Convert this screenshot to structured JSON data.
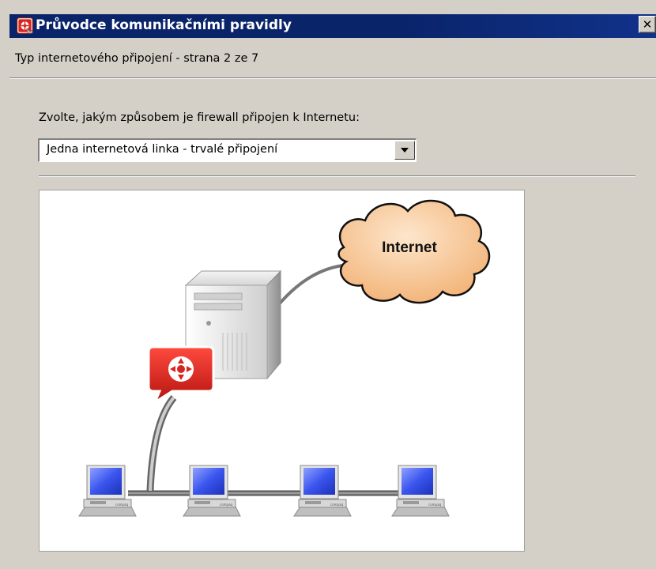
{
  "window": {
    "title": "Průvodce komunikačními pravidly",
    "app_icon": "firewall-wizard-icon",
    "close_icon": "close-icon",
    "close_label": "✕"
  },
  "page": {
    "subtitle": "Typ internetového připojení - strana 2 ze 7",
    "prompt": "Zvolte, jakým způsobem je firewall připojen k Internetu:"
  },
  "connection_select": {
    "selected_value": "Jedna internetová linka - trvalé připojení",
    "arrow_icon": "dropdown-arrow-icon"
  },
  "diagram": {
    "cloud_label": "Internet",
    "workstation_label": "compaq"
  },
  "colors": {
    "titlebar": "#0a246a",
    "dialog_bg": "#d4d0c8",
    "cloud_fill": "#f7c28a",
    "badge_red": "#d9231f",
    "screen_blue": "#2f47e6"
  }
}
